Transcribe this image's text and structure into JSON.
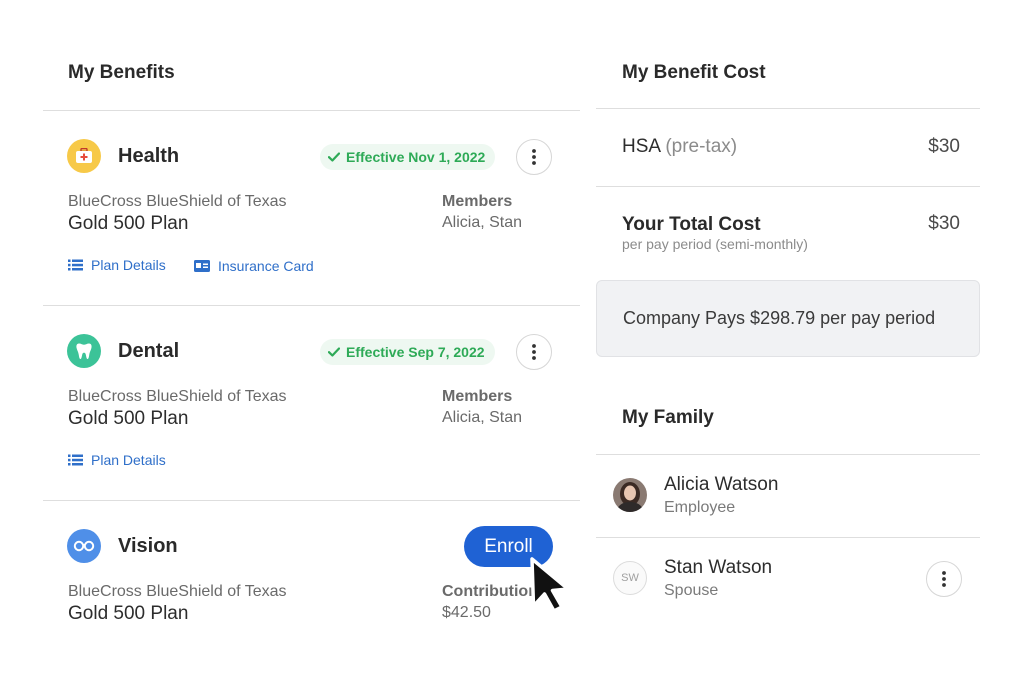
{
  "benefits": {
    "title": "My Benefits",
    "items": [
      {
        "name": "Health",
        "icon": "first-aid-kit-icon",
        "icon_color": "#f7c948",
        "status": "Effective Nov 1, 2022",
        "carrier": "BlueCross BlueShield of Texas",
        "plan": "Gold 500 Plan",
        "meta_label": "Members",
        "meta_value": "Alicia, Stan",
        "links": [
          "Plan Details",
          "Insurance Card"
        ]
      },
      {
        "name": "Dental",
        "icon": "tooth-icon",
        "icon_color": "#3cc398",
        "status": "Effective Sep 7, 2022",
        "carrier": "BlueCross BlueShield of Texas",
        "plan": "Gold 500 Plan",
        "meta_label": "Members",
        "meta_value": "Alicia, Stan",
        "links": [
          "Plan Details"
        ]
      },
      {
        "name": "Vision",
        "icon": "glasses-icon",
        "icon_color": "#4f8fe8",
        "action": "Enroll",
        "carrier": "BlueCross BlueShield of Texas",
        "plan": "Gold 500 Plan",
        "meta_label": "Contribution",
        "meta_value": "$42.50"
      }
    ]
  },
  "cost": {
    "title": "My Benefit Cost",
    "hsa_label": "HSA",
    "hsa_qualifier": "(pre-tax)",
    "hsa_value": "$30",
    "total_label": "Your Total Cost",
    "total_sub": "per pay period (semi-monthly)",
    "total_value": "$30",
    "company_pays": "Company Pays $298.79 per pay period"
  },
  "family": {
    "title": "My Family",
    "members": [
      {
        "name": "Alicia Watson",
        "role": "Employee",
        "avatar": "photo"
      },
      {
        "name": "Stan Watson",
        "role": "Spouse",
        "initials": "SW"
      }
    ]
  },
  "colors": {
    "accent": "#1f62d4",
    "status_green": "#2eaa57",
    "link_blue": "#2f6fc9"
  }
}
